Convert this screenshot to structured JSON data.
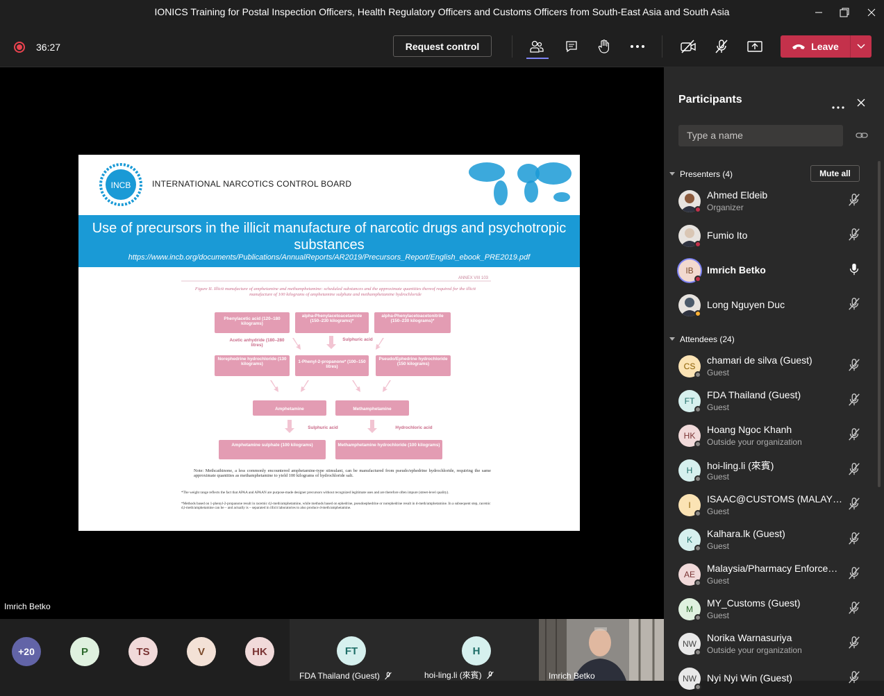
{
  "window": {
    "title": "IONICS Training for Postal Inspection Officers, Health Regulatory Officers and Customs Officers from South-East Asia and South Asia"
  },
  "toolbar": {
    "timer": "36:27",
    "request_control": "Request control",
    "leave": "Leave"
  },
  "slide": {
    "org_name": "INTERNATIONAL NARCOTICS CONTROL BOARD",
    "logo_text": "INCB",
    "title": "Use of precursors in the illicit manufacture of narcotic drugs and psychotropic substances",
    "url": "https://www.incb.org/documents/Publications/AnnualReports/AR2019/Precursors_Report/English_ebook_PRE2019.pdf",
    "annex": "ANNEX VIII     103",
    "figure_caption": "Figure II.   Illicit manufacture of amphetamine and methamphetamine: scheduled substances and the approximate quantities thereof required for the illicit manufacture of 100 kilograms of amphetamine sulphate and methamphetamine hydrochloride",
    "boxes": {
      "b1": "Phenylacetic acid (120–180 kilograms)",
      "b2": "alpha-Phenylacetoacetamide (150–230 kilograms)*",
      "b3": "alpha-Phenylacetoacetonitrile (150–230 kilograms)*",
      "b4": "Norephedrine hydrochloride (130 kilograms)",
      "b5": "1-Phenyl-2-propanone* (100–150 litres)",
      "b6": "Pseudo/Ephedrine hydrochloride (150 kilograms)",
      "b7": "Amphetamine",
      "b8": "Methamphetamine",
      "b9": "Amphetamine sulphate (100 kilograms)",
      "b10": "Methamphetamine hydrochloride (100 kilograms)"
    },
    "labels": {
      "l1": "Acetic anhydride (180–280 litres)",
      "l2": "Sulphuric acid",
      "l3": "Sulphuric acid",
      "l4": "Hydrochloric acid"
    },
    "note": "Note:   Methcathinone, a less commonly encountered amphetamine-type stimulant, can be manufactured from pseudo/ephedrine hydrochloride, requiring the same approximate quantities as methamphetamine to yield 100 kilograms of hydrochloride salt.",
    "footnote1": "*The weight range reflects the fact that APAA and APAAN are purpose-made designer precursors without recognized legitimate uses and are therefore often impure (street-level quality).",
    "footnote2": "*Methods based on 1-phenyl-2-propanone result in racemic d,l-meth/amphetamine, while methods based on ephedrine, pseudoephedrine or norephedrine result in d-meth/amphetamine. In a subsequent step, racemic d,l-meth/amphetamine can be – and actually is – separated in illicit laboratories to also produce d-meth/amphetamine."
  },
  "stage": {
    "speaker_name": "Imrich Betko"
  },
  "bottom_bar": {
    "overflow": "+20",
    "avatars": [
      "P",
      "TS",
      "V",
      "HK"
    ],
    "tiles": [
      {
        "initials": "FT",
        "name": "FDA Thailand (Guest)"
      },
      {
        "initials": "H",
        "name": "hoi-ling.li (來賓)"
      }
    ],
    "video_name": "Imrich Betko"
  },
  "panel": {
    "title": "Participants",
    "search_placeholder": "Type a name",
    "presenters_label": "Presenters (4)",
    "mute_all": "Mute all",
    "attendees_label": "Attendees (24)",
    "presenters": [
      {
        "name": "Ahmed Eldeib",
        "sub": "Organizer",
        "initials": "",
        "status": "#c4314b",
        "mic": "muted"
      },
      {
        "name": "Fumio Ito",
        "sub": "",
        "initials": "",
        "status": "#c4314b",
        "mic": "muted"
      },
      {
        "name": "Imrich Betko",
        "sub": "",
        "initials": "IB",
        "status": "#c4314b",
        "mic": "on"
      },
      {
        "name": "Long Nguyen Duc",
        "sub": "",
        "initials": "",
        "status": "#fcb034",
        "mic": "muted"
      }
    ],
    "attendees": [
      {
        "name": "chamari de silva (Guest)",
        "sub": "Guest",
        "initials": "CS",
        "color": "#fbe3b4",
        "fg": "#8a5d00"
      },
      {
        "name": "FDA Thailand (Guest)",
        "sub": "Guest",
        "initials": "FT",
        "color": "#d6f0ee",
        "fg": "#1f6e68"
      },
      {
        "name": "Hoang Ngoc Khanh",
        "sub": "Outside your organization",
        "initials": "HK",
        "color": "#f1dada",
        "fg": "#7a3434"
      },
      {
        "name": "hoi-ling.li (來賓)",
        "sub": "Guest",
        "initials": "H",
        "color": "#d6f0ee",
        "fg": "#1f6e68"
      },
      {
        "name": "ISAAC@CUSTOMS (MALAYSI...",
        "sub": "Guest",
        "initials": "I",
        "color": "#fbe3b4",
        "fg": "#8a5d00"
      },
      {
        "name": "Kalhara.lk (Guest)",
        "sub": "Guest",
        "initials": "K",
        "color": "#d6f0ee",
        "fg": "#1f6e68"
      },
      {
        "name": "Malaysia/Pharmacy Enforcem...",
        "sub": "Guest",
        "initials": "AE",
        "color": "#f1dada",
        "fg": "#7a3434"
      },
      {
        "name": "MY_Customs (Guest)",
        "sub": "Guest",
        "initials": "M",
        "color": "#dff1df",
        "fg": "#2d6a2d"
      },
      {
        "name": "Norika Warnasuriya",
        "sub": "Outside your organization",
        "initials": "NW",
        "color": "#e8e8e8",
        "fg": "#444444"
      },
      {
        "name": "Nyi Nyi Win (Guest)",
        "sub": "",
        "initials": "NW",
        "color": "#e8e8e8",
        "fg": "#444444"
      }
    ]
  },
  "colors": {
    "leave": "#c4314b",
    "band": "#1a9ad6",
    "flow_box": "#e39cb3"
  }
}
